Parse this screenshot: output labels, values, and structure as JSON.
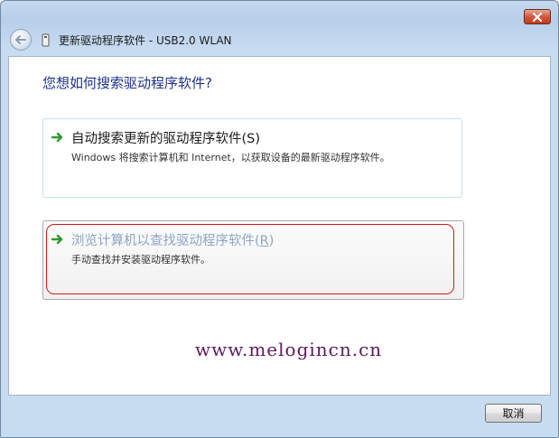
{
  "window": {
    "title": "更新驱动程序软件 - USB2.0 WLAN",
    "close_icon": "close-icon",
    "back_icon": "back-arrow-icon",
    "title_icon": "device-icon"
  },
  "content": {
    "question": "您想如何搜索驱动程序软件?",
    "options": [
      {
        "icon": "green-arrow-icon",
        "title": "自动搜索更新的驱动程序软件(S)",
        "description": "Windows 将搜索计算机和 Internet，以获取设备的最新驱动程序软件。"
      },
      {
        "icon": "green-arrow-icon",
        "title_main": "浏览计算机以查找驱动程序软件(",
        "title_key": "R",
        "title_end": ")",
        "description": "手动查找并安装驱动程序软件。",
        "highlight_color": "#d01a1a"
      }
    ],
    "watermark": "www.melogincn.cn"
  },
  "footer": {
    "cancel_label": "取消"
  },
  "colors": {
    "accent_heading": "#1e3287",
    "arrow_green": "#2e9a2e",
    "frame": "#c8dcf1"
  }
}
